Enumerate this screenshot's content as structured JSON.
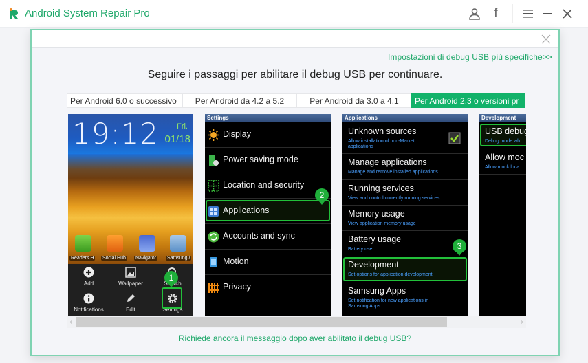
{
  "app": {
    "title": "Android System Repair Pro",
    "brand_color": "#1fa86a",
    "titlebar_icons": [
      "user-icon",
      "facebook-icon",
      "menu-icon",
      "minimize-icon",
      "close-icon"
    ],
    "facebook_glyph": "f"
  },
  "dialog": {
    "top_link": "Impostazioni di debug USB più specifiche>>",
    "heading": "Seguire i passaggi per abilitare il debug USB per continuare.",
    "tabs": [
      {
        "label": "Per Android 6.0 o successivo",
        "active": false
      },
      {
        "label": "Per Android da 4.2 a 5.2",
        "active": false
      },
      {
        "label": "Per Android da 3.0 a 4.1",
        "active": false
      },
      {
        "label": "Per Android 2.3 o versioni pr",
        "active": true
      }
    ],
    "bottom_link": "Richiede ancora il messaggio dopo aver abilitato il debug USB?",
    "scroll_left": "‹",
    "scroll_right": "›"
  },
  "screens": {
    "home": {
      "clock": "19:12",
      "day": "Fri.",
      "date": "01/18",
      "apps": [
        "Readers H",
        "Social Hub",
        "Navigator",
        "Samsung /"
      ],
      "menu": [
        "Add",
        "Wallpaper",
        "Search",
        "Notifications",
        "Edit",
        "Settings"
      ],
      "step": "1"
    },
    "settings": {
      "title": "Settings",
      "items": [
        "Display",
        "Power saving mode",
        "Location and security",
        "Applications",
        "Accounts and sync",
        "Motion",
        "Privacy"
      ],
      "step": "2"
    },
    "applications": {
      "title": "Applications",
      "items": [
        {
          "label": "Unknown sources",
          "sub": "Allow installation of non-Market",
          "sub2": "applications",
          "checked": true
        },
        {
          "label": "Manage applications",
          "sub": "Manage and remove installed applications"
        },
        {
          "label": "Running services",
          "sub": "View and control currently running services"
        },
        {
          "label": "Memory usage",
          "sub": "View application memory usage"
        },
        {
          "label": "Battery usage",
          "sub": "Battery use"
        },
        {
          "label": "Development",
          "sub": "Set options for application development"
        },
        {
          "label": "Samsung Apps",
          "sub": "Set notification for new applications in",
          "sub2": "Samsung Apps"
        }
      ],
      "step": "3"
    },
    "development": {
      "title": "Development",
      "items": [
        {
          "label": "USB debug",
          "sub": "Debug mode wh"
        },
        {
          "label": "Allow moc",
          "sub": "Allow mock loca"
        }
      ]
    }
  }
}
